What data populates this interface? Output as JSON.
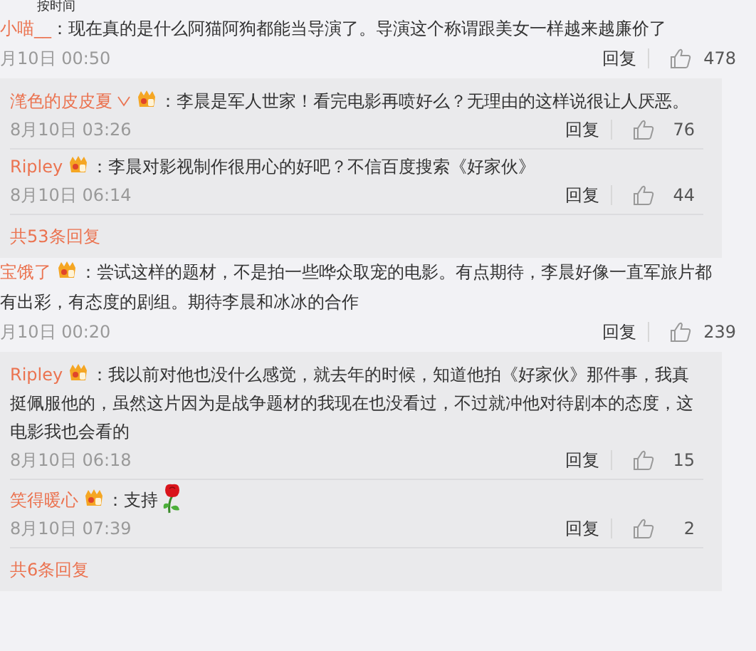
{
  "sort_label": "按时间",
  "threads": [
    {
      "author": "小喵__",
      "badge": false,
      "lines": [
        "：现在真的是什么阿猫阿狗都能当导演了。导演这个称谓跟美女一样越来越廉价了"
      ],
      "time": "月10日 00:50",
      "reply_label": "回复",
      "likes": "478",
      "replies": [
        {
          "author": "滗色的皮皮夏",
          "verified": true,
          "badge": true,
          "text": "：李晨是军人世家！看完电影再喷好么？无理由的这样说很让人厌恶。",
          "emoji": false,
          "time": "8月10日 03:26",
          "reply_label": "回复",
          "likes": "76"
        },
        {
          "author": "Ripley",
          "verified": false,
          "badge": true,
          "text": "：李晨对影视制作很用心的好吧？不信百度搜索《好家伙》",
          "emoji": false,
          "time": "8月10日 06:14",
          "reply_label": "回复",
          "likes": "44"
        }
      ],
      "more": "共53条回复"
    },
    {
      "author": "宝饿了",
      "badge": true,
      "lines": [
        "：尝试这样的题材，不是拍一些哗众取宠的电影。有点期待，李晨好像一直军旅片都",
        "有出彩，有态度的剧组。期待李晨和冰冰的合作"
      ],
      "time": "月10日 00:20",
      "reply_label": "回复",
      "likes": "239",
      "replies": [
        {
          "author": "Ripley",
          "verified": false,
          "badge": true,
          "text": "：我以前对他也没什么感觉，就去年的时候，知道他拍《好家伙》那件事，我真挺佩服他的，虽然这片因为是战争题材的我现在也没看过，不过就冲他对待剧本的态度，这电影我也会看的",
          "emoji": false,
          "time": "8月10日 06:18",
          "reply_label": "回复",
          "likes": "15"
        },
        {
          "author": "笑得暖心",
          "verified": false,
          "badge": true,
          "text": "：支持",
          "emoji": true,
          "time": "8月10日 07:39",
          "reply_label": "回复",
          "likes": "2"
        }
      ],
      "more": "共6条回复"
    }
  ]
}
